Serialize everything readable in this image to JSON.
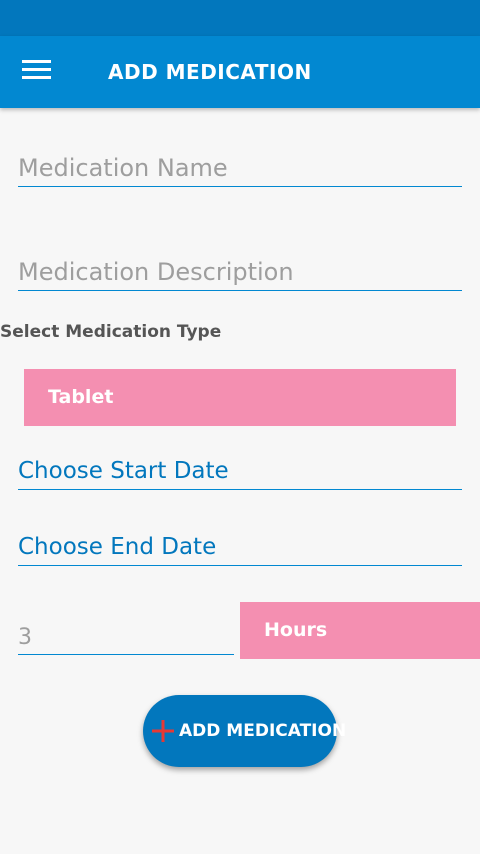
{
  "app_bar": {
    "title": "ADD MEDICATION",
    "menu_icon": "hamburger-menu-icon",
    "color": "#0288d1",
    "status_bar_color": "#0277bd"
  },
  "form": {
    "name_placeholder": "Medication Name",
    "description_placeholder": "Medication Description",
    "type_label": "Select Medication Type",
    "type_selected": "Tablet",
    "start_date_label": "Choose Start Date",
    "end_date_label": "Choose End Date",
    "interval_value": "3",
    "interval_unit": "Hours",
    "spinner_color": "#f48fb1"
  },
  "add_button": {
    "label": "ADD MEDICATION",
    "icon": "plus-icon",
    "plus_color": "#e53935"
  }
}
